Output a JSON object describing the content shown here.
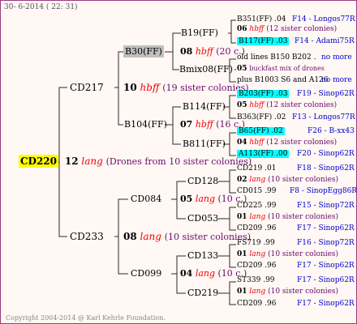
{
  "header": "30- 6-2014 ( 22: 31)",
  "footer": "Copyright 2004-2014 @ Karl Kehrle Foundation.",
  "root": {
    "name": "CD220",
    "num": "12",
    "race": "lang",
    "desc": "(Drones from 10 sister colonies)"
  },
  "gen1": [
    {
      "name": "CD217",
      "num": "10",
      "race": "hbff",
      "desc": "(19 sister colonies)"
    },
    {
      "name": "CD233",
      "num": "08",
      "race": "lang",
      "desc": "(10 sister colonies)"
    }
  ],
  "gen2": [
    {
      "name": "B30(FF)",
      "num": "08",
      "race": "hbff",
      "desc": "(20 c.)"
    },
    {
      "name": "B104(FF)",
      "num": "07",
      "race": "hbff",
      "desc": "(16 c.)"
    },
    {
      "name": "CD084",
      "num": "05",
      "race": "lang",
      "desc": "(10 c.)"
    },
    {
      "name": "CD099",
      "num": "04",
      "race": "lang",
      "desc": "(10 c.)"
    }
  ],
  "gen3": [
    {
      "name": "B19(FF)"
    },
    {
      "name": "Bmix08(FF)"
    },
    {
      "name": "B114(FF)"
    },
    {
      "name": "B811(FF)"
    },
    {
      "name": "CD128"
    },
    {
      "name": "CD053"
    },
    {
      "name": "CD133"
    },
    {
      "name": "CD219"
    }
  ],
  "gen4": [
    {
      "a": "B351(FF) .04",
      "b": "F14 - Longos77R"
    },
    {
      "num": "06",
      "race": "hbff",
      "desc": "(12 sister colonies)"
    },
    {
      "a": "B117(FF) .03",
      "b": "F14 - Adami75R"
    },
    {
      "a": "old lines B150 B202 .",
      "b": "no more"
    },
    {
      "num": "05",
      "desc": "buckfast mix of drones"
    },
    {
      "a": "plus B1003 S6 and A126",
      "b": "no more"
    },
    {
      "a": "B203(FF) .03",
      "b": "F19 - Sinop62R"
    },
    {
      "num": "05",
      "race": "hbff",
      "desc": "(12 sister colonies)"
    },
    {
      "a": "B363(FF) .02",
      "b": "F13 - Longos77R"
    },
    {
      "a": "B65(FF) .02",
      "b": "F26 - B-xx43"
    },
    {
      "num": "04",
      "race": "hbff",
      "desc": "(12 sister colonies)"
    },
    {
      "a": "A113(FF) .00",
      "b": "F20 - Sinop62R"
    },
    {
      "a": "CD219 .01",
      "b": "F18 - Sinop62R"
    },
    {
      "num": "02",
      "race": "lang",
      "desc": "(10 sister colonies)"
    },
    {
      "a": "CD015 .99",
      "b": "F8 - SinopEgg86R"
    },
    {
      "a": "CD225 .99",
      "b": "F15 - Sinop72R"
    },
    {
      "num": "01",
      "race": "lang",
      "desc": "(10 sister colonies)"
    },
    {
      "a": "CD209 .96",
      "b": "F17 - Sinop62R"
    },
    {
      "a": "FS719 .99",
      "b": "F16 - Sinop72R"
    },
    {
      "num": "01",
      "race": "lang",
      "desc": "(10 sister colonies)"
    },
    {
      "a": "CD209 .96",
      "b": "F17 - Sinop62R"
    },
    {
      "a": "ST339 .99",
      "b": "F17 - Sinop62R"
    },
    {
      "num": "01",
      "race": "lang",
      "desc": "(10 sister colonies)"
    },
    {
      "a": "CD209 .96",
      "b": "F17 - Sinop62R"
    }
  ],
  "colors": {
    "border": "#9c3a7c",
    "line": "#2a2a2a",
    "race": "#ee0000",
    "desc": "#6a0a6a",
    "code": "#0000cc",
    "cyan": "#00ffff",
    "gray": "#c0c0c0",
    "yellow": "#ffff00"
  }
}
